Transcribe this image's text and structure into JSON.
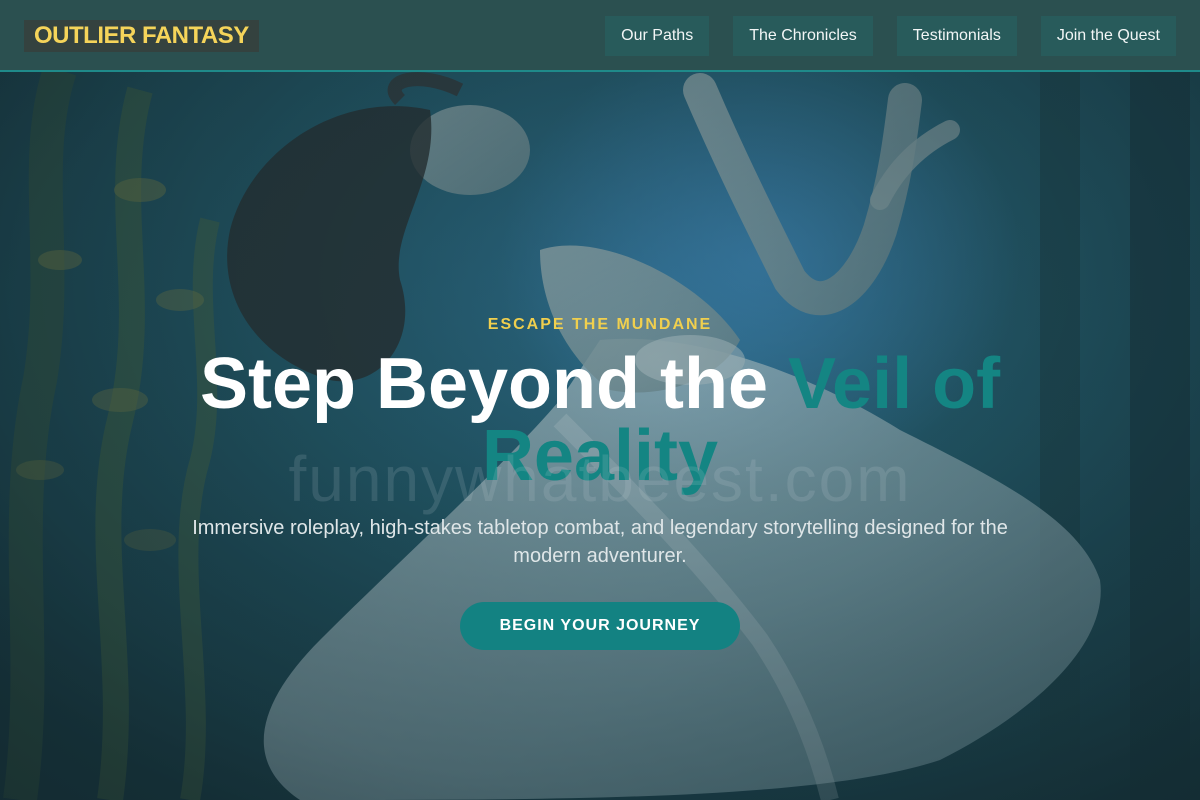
{
  "header": {
    "logo": "OUTLIER FANTASY",
    "nav": [
      {
        "label": "Our Paths"
      },
      {
        "label": "The Chronicles"
      },
      {
        "label": "Testimonials"
      },
      {
        "label": "Join the Quest"
      }
    ]
  },
  "hero": {
    "eyebrow": "ESCAPE THE MUNDANE",
    "headline_main": "Step Beyond the ",
    "headline_accent": "Veil of Reality",
    "watermark": "funnywhatbeest.com",
    "subtitle": "Immersive roleplay, high-stakes tabletop combat, and legendary storytelling designed for the modern adventurer.",
    "cta": "BEGIN YOUR JOURNEY"
  },
  "colors": {
    "header_bg": "#2b5050",
    "logo_text": "#f5d45a",
    "eyebrow": "#f0cf4e",
    "accent": "#148583",
    "cta_bg": "#138282"
  }
}
